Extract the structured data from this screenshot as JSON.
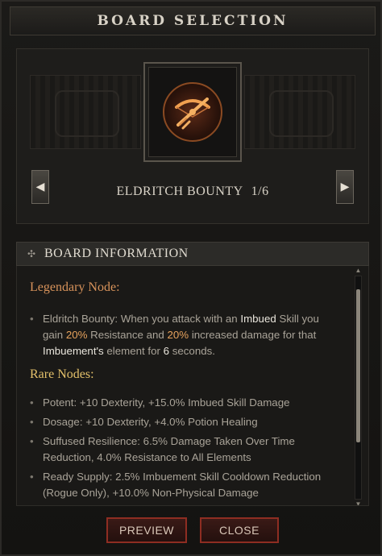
{
  "window": {
    "title": "BOARD SELECTION"
  },
  "board": {
    "name": "ELDRITCH BOUNTY",
    "index": "1",
    "separator": "/",
    "total": "6",
    "emblem_icon": "crossbow-emblem-icon",
    "prev_icon": "chevron-left-icon",
    "next_icon": "chevron-right-icon",
    "prev_glyph": "◀",
    "next_glyph": "▶"
  },
  "info": {
    "header": "BOARD INFORMATION",
    "header_glyph": "✣",
    "legendary_title": "Legendary Node:",
    "legendary": {
      "p1": "Eldritch Bounty: When you attack with an ",
      "w1": "Imbued",
      "p2": " Skill you gain ",
      "o1": "20%",
      "p3": " Resistance and ",
      "o2": "20%",
      "p4": " increased damage for that ",
      "w2": "Imbuement's",
      "p5": " element for ",
      "w3": "6",
      "p6": " seconds."
    },
    "rare_title": "Rare Nodes:",
    "rare_nodes": [
      "Potent: +10 Dexterity, +15.0% Imbued Skill Damage",
      "Dosage: +10 Dexterity, +4.0% Potion Healing",
      "Suffused Resilience: 6.5% Damage Taken Over Time Reduction, 4.0% Resistance to All Elements",
      "Ready Supply: 2.5% Imbuement Skill Cooldown Reduction (Rogue Only), +10.0% Non-Physical Damage"
    ]
  },
  "footer": {
    "preview_label": "PREVIEW",
    "close_label": "CLOSE"
  },
  "colors": {
    "legendary": "#d8935b",
    "rare": "#e3c06a",
    "highlight_orange": "#e6a25d",
    "button_border": "#8e2d22"
  }
}
